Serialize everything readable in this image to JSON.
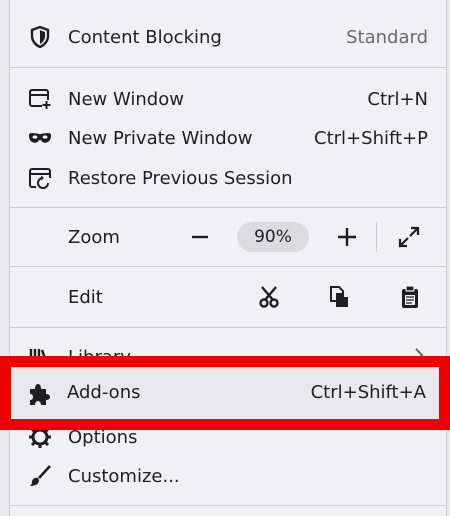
{
  "menu": {
    "content_blocking": {
      "label": "Content Blocking",
      "status": "Standard",
      "icon": "shield-icon"
    },
    "new_window": {
      "label": "New Window",
      "shortcut": "Ctrl+N",
      "icon": "new-window-icon"
    },
    "new_private_window": {
      "label": "New Private Window",
      "shortcut": "Ctrl+Shift+P",
      "icon": "private-mask-icon"
    },
    "restore_session": {
      "label": "Restore Previous Session",
      "icon": "restore-session-icon"
    },
    "zoom": {
      "label": "Zoom",
      "level": "90%",
      "icons": [
        "minus-icon",
        "plus-icon",
        "fullscreen-icon"
      ]
    },
    "edit": {
      "label": "Edit",
      "icons": [
        "cut-icon",
        "copy-icon",
        "paste-icon"
      ]
    },
    "library": {
      "label": "Library",
      "icon": "library-icon"
    },
    "addons": {
      "label": "Add-ons",
      "shortcut": "Ctrl+Shift+A",
      "icon": "puzzle-icon"
    },
    "options": {
      "label": "Options",
      "icon": "gear-icon"
    },
    "customize": {
      "label": "Customize...",
      "icon": "paintbrush-icon"
    }
  },
  "highlight_color": "#ee0000"
}
